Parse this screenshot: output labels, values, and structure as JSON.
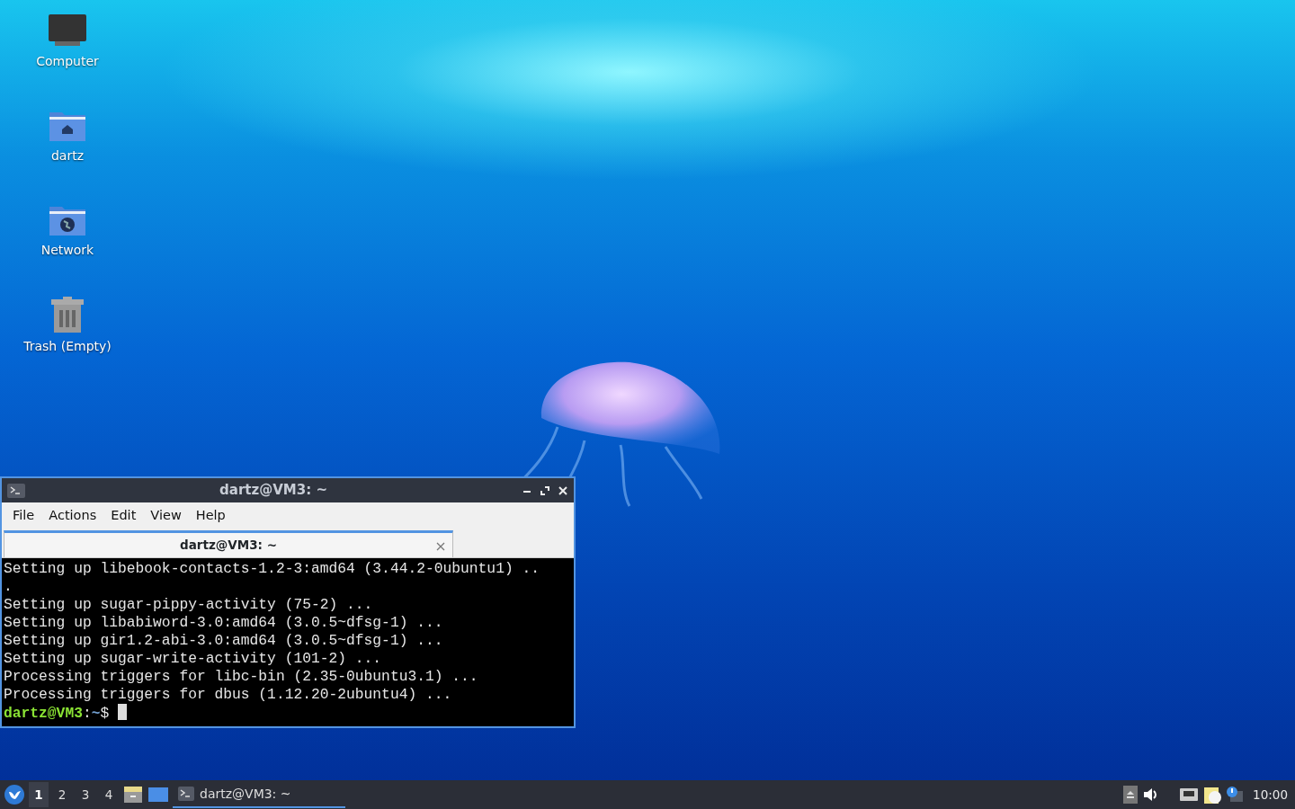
{
  "desktop_icons": [
    {
      "kind": "computer",
      "label": "Computer"
    },
    {
      "kind": "home",
      "label": "dartz"
    },
    {
      "kind": "network",
      "label": "Network"
    },
    {
      "kind": "trash",
      "label": "Trash (Empty)"
    }
  ],
  "terminal": {
    "title": "dartz@VM3: ~",
    "menu": [
      "File",
      "Actions",
      "Edit",
      "View",
      "Help"
    ],
    "tabs": [
      {
        "label": "dartz@VM3: ~",
        "selected": true
      }
    ],
    "lines": [
      "Setting up libebook-contacts-1.2-3:amd64 (3.44.2-0ubuntu1) ..",
      ".",
      "Setting up sugar-pippy-activity (75-2) ...",
      "Setting up libabiword-3.0:amd64 (3.0.5~dfsg-1) ...",
      "Setting up gir1.2-abi-3.0:amd64 (3.0.5~dfsg-1) ...",
      "Setting up sugar-write-activity (101-2) ...",
      "Processing triggers for libc-bin (2.35-0ubuntu3.1) ...",
      "Processing triggers for dbus (1.12.20-2ubuntu4) ..."
    ],
    "prompt": {
      "user_host": "dartz@VM3",
      "separator": ":",
      "path": "~",
      "symbol": "$"
    }
  },
  "taskbar": {
    "workspaces": [
      {
        "label": "1",
        "selected": true
      },
      {
        "label": "2",
        "selected": false
      },
      {
        "label": "3",
        "selected": false
      },
      {
        "label": "4",
        "selected": false
      }
    ],
    "tasks": [
      {
        "label": "dartz@VM3: ~",
        "selected": true
      }
    ],
    "clock": "10:00"
  }
}
